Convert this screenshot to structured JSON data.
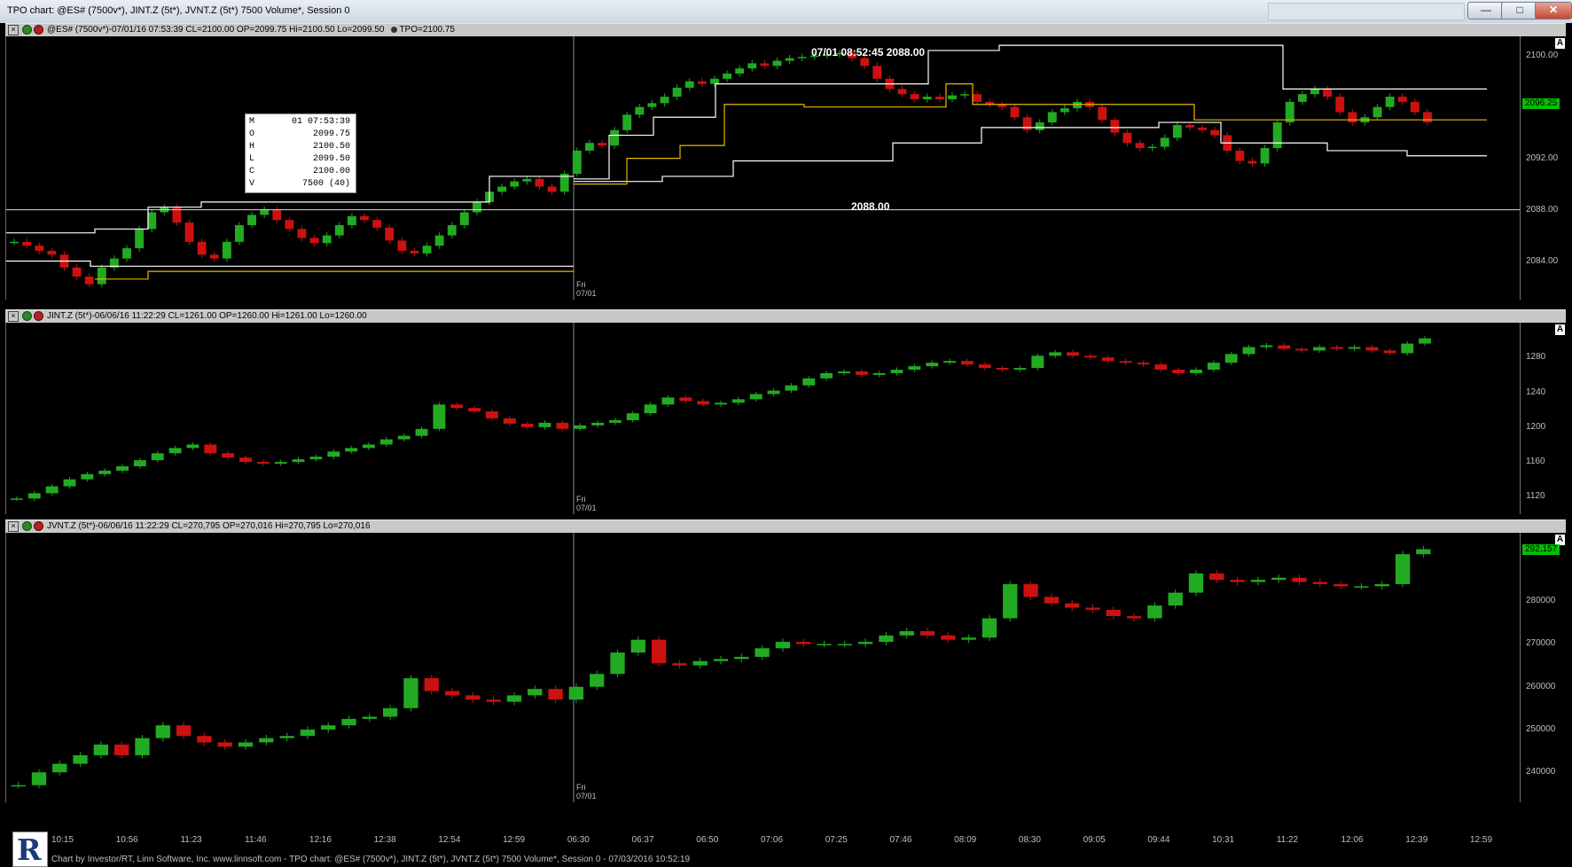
{
  "window": {
    "title": "TPO chart: @ES# (7500v*), JINT.Z (5t*), JVNT.Z (5t*) 7500 Volume*, Session 0",
    "minimize": "—",
    "maximize": "□",
    "close": "✕"
  },
  "panes": [
    {
      "header": "@ES# (7500v*)-07/01/16 07:53:39 CL=2100.00 OP=2099.75 Hi=2100.50 Lo=2099.50",
      "tpo_label": "TPO=2100.75",
      "y_ticks": [
        "2100.00",
        "2096.25",
        "2092.00",
        "2088.00",
        "2084.00"
      ],
      "current_price": "2096.25",
      "autoscale": "A",
      "session_marker": [
        "Fri",
        "07/01"
      ]
    },
    {
      "header": "JINT.Z (5t*)-06/06/16 11:22:29 CL=1261.00 OP=1260.00 Hi=1261.00 Lo=1260.00",
      "y_ticks": [
        "1280",
        "1240",
        "1200",
        "1160",
        "1120"
      ],
      "autoscale": "A",
      "session_marker": [
        "Fri",
        "07/01"
      ]
    },
    {
      "header": "JVNT.Z (5t*)-06/06/16 11:22:29 CL=270,795 OP=270,016 Hi=270,795 Lo=270,016",
      "y_ticks": [
        "280000",
        "270000",
        "260000",
        "250000",
        "240000"
      ],
      "current_price": "292,157",
      "autoscale": "A",
      "session_marker": [
        "Fri",
        "07/01"
      ]
    }
  ],
  "infobox": {
    "rows": [
      {
        "k": "M",
        "v": "01 07:53:39"
      },
      {
        "k": "O",
        "v": "2099.75"
      },
      {
        "k": "H",
        "v": "2100.50"
      },
      {
        "k": "L",
        "v": "2099.50"
      },
      {
        "k": "C",
        "v": "2100.00"
      },
      {
        "k": "V",
        "v": "7500 (40)"
      }
    ]
  },
  "annotations": {
    "crosshair_time": "07/01 08:52:45 2088.00",
    "crosshair_price": "2088.00"
  },
  "x_ticks": [
    "10:15",
    "10:56",
    "11:23",
    "11:46",
    "12:16",
    "12:38",
    "12:54",
    "12:59",
    "06:30",
    "06:37",
    "06:50",
    "07:06",
    "07:25",
    "07:46",
    "08:09",
    "08:30",
    "09:05",
    "09:44",
    "10:31",
    "11:22",
    "12:06",
    "12:39",
    "12:59"
  ],
  "footer": "Chart by Investor/RT, Linn Software, Inc. www.linnsoft.com - TPO chart: @ES# (7500v*), JINT.Z (5t*), JVNT.Z (5t*) 7500 Volume*, Session 0 - 07/03/2016 10:52:19",
  "logo_letter": "R",
  "colors": {
    "up": "#22aa22",
    "down": "#cc1111",
    "value_area": "#ffffff",
    "poc": "#e6b800"
  },
  "chart_data": [
    {
      "type": "candlestick",
      "series": [
        {
          "name": "@ES#",
          "values": [
            2085.5,
            2085.2,
            2084.8,
            2084.5,
            2083.5,
            2082.8,
            2082.2,
            2083.5,
            2084.2,
            2085.0,
            2086.5,
            2087.8,
            2088.2,
            2087.0,
            2085.5,
            2084.5,
            2084.2,
            2085.5,
            2086.8,
            2087.6,
            2088.0,
            2087.2,
            2086.5,
            2085.8,
            2085.4,
            2086.0,
            2086.8,
            2087.5,
            2087.2,
            2086.6,
            2085.6,
            2084.8,
            2084.6,
            2085.2,
            2086.0,
            2086.8,
            2087.8,
            2088.6,
            2089.4,
            2089.8,
            2090.2,
            2090.4,
            2089.8,
            2089.4,
            2090.8,
            2092.6,
            2093.2,
            2093.0,
            2094.2,
            2095.4,
            2096.0,
            2096.3,
            2096.8,
            2097.5,
            2098.0,
            2097.8,
            2098.2,
            2098.6,
            2099.0,
            2099.4,
            2099.2,
            2099.6,
            2099.8,
            2099.9,
            2100.0,
            2100.1,
            2100.2,
            2099.8,
            2099.2,
            2098.2,
            2097.4,
            2097.0,
            2096.6,
            2096.8,
            2096.6,
            2096.9,
            2097.0,
            2096.4,
            2096.2,
            2096.0,
            2095.2,
            2094.2,
            2094.8,
            2095.6,
            2095.9,
            2096.4,
            2096.0,
            2095.0,
            2094.0,
            2093.2,
            2092.8,
            2092.9,
            2093.6,
            2094.6,
            2094.4,
            2094.2,
            2093.8,
            2092.6,
            2091.8,
            2091.6,
            2092.8,
            2094.8,
            2096.4,
            2097.0,
            2097.4,
            2096.8,
            2095.6,
            2094.8,
            2095.2,
            2096.0,
            2096.8,
            2096.4,
            2095.6,
            2094.8
          ]
        }
      ],
      "ylim": [
        2081.0,
        2101.5
      ],
      "value_area_high": 2100.75,
      "value_area_low": 2092.25,
      "poc": 2095.0
    },
    {
      "type": "candlestick",
      "series": [
        {
          "name": "JINT.Z",
          "values": [
            1118,
            1124,
            1132,
            1140,
            1146,
            1150,
            1155,
            1162,
            1170,
            1176,
            1180,
            1170,
            1165,
            1160,
            1158,
            1160,
            1163,
            1166,
            1172,
            1176,
            1180,
            1186,
            1190,
            1198,
            1226,
            1222,
            1218,
            1210,
            1204,
            1200,
            1205,
            1198,
            1202,
            1205,
            1208,
            1216,
            1226,
            1234,
            1230,
            1226,
            1228,
            1232,
            1238,
            1242,
            1248,
            1256,
            1262,
            1264,
            1260,
            1262,
            1266,
            1270,
            1274,
            1276,
            1272,
            1268,
            1266,
            1268,
            1282,
            1286,
            1282,
            1280,
            1276,
            1274,
            1272,
            1266,
            1262,
            1266,
            1274,
            1284,
            1292,
            1294,
            1290,
            1288,
            1292,
            1290,
            1292,
            1288,
            1285,
            1296,
            1302
          ]
        }
      ],
      "ylim": [
        1100,
        1320
      ]
    },
    {
      "type": "candlestick",
      "series": [
        {
          "name": "JVNT.Z",
          "values": [
            237000,
            240000,
            242000,
            244000,
            246500,
            244000,
            248000,
            251000,
            248500,
            247000,
            246000,
            247000,
            248000,
            248500,
            250000,
            251000,
            252500,
            253000,
            255000,
            262000,
            259000,
            258000,
            257000,
            256500,
            258000,
            259500,
            257000,
            260000,
            263000,
            268000,
            271000,
            265500,
            265000,
            266000,
            266500,
            267000,
            269000,
            270500,
            270000,
            270000,
            270000,
            270500,
            272000,
            273000,
            272000,
            271000,
            271500,
            276000,
            284000,
            281000,
            279500,
            278500,
            278000,
            276500,
            276000,
            279000,
            282000,
            286500,
            285000,
            284500,
            285000,
            285500,
            284500,
            284000,
            283500,
            283500,
            284000,
            291000,
            292157
          ]
        }
      ],
      "ylim": [
        233000,
        296000
      ]
    }
  ]
}
